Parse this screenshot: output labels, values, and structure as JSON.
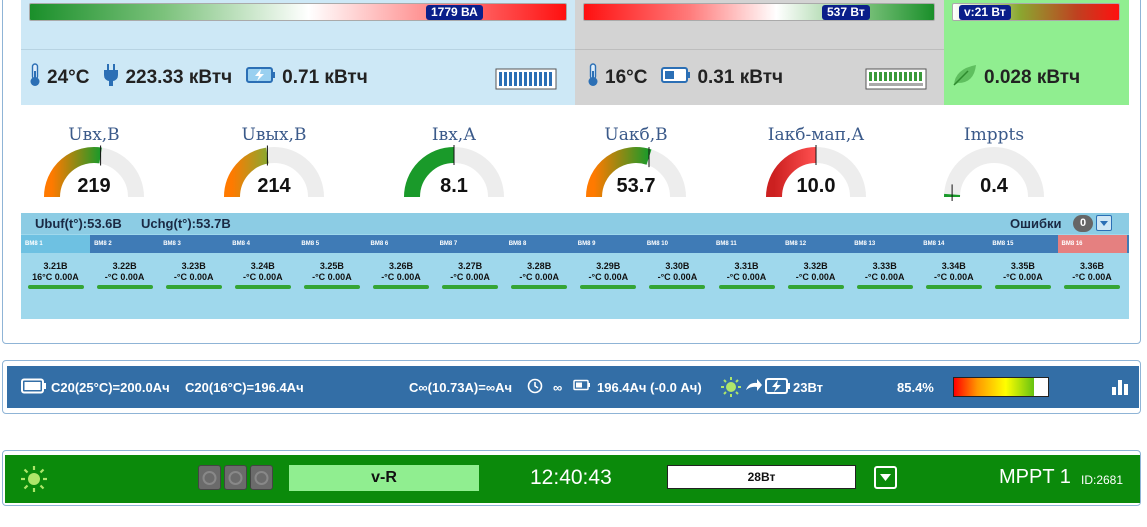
{
  "top": {
    "grid": {
      "gradient_value": "1779 ВА",
      "temp": "24°C",
      "energy_in": "223.33 кВтч",
      "energy_bat": "0.71 кВтч"
    },
    "battery": {
      "gradient_value": "537 Вт",
      "temp": "16°C",
      "energy": "0.31 кВтч"
    },
    "pv": {
      "gradient_value": "v:21 Вт",
      "energy": "0.028 кВтч"
    }
  },
  "gauges": [
    {
      "label": "Uвх,В",
      "value": "219",
      "level": 0.55,
      "colors": [
        "#ff7a00",
        "#1a9a2a"
      ]
    },
    {
      "label": "Uвых,В",
      "value": "214",
      "level": 0.45,
      "colors": [
        "#ff7a00",
        "#8aa830"
      ]
    },
    {
      "label": "Iвх,А",
      "value": "8.1",
      "level": 0.5,
      "colors": [
        "#1a9a2a",
        "#1a9a2a"
      ]
    },
    {
      "label": "Uакб,В",
      "value": "53.7",
      "level": 0.6,
      "colors": [
        "#ff7a00",
        "#1a9a2a"
      ]
    },
    {
      "label": "Iакб-мап,А",
      "value": "10.0",
      "level": 0.5,
      "colors": [
        "#cc2020",
        "#ff5050"
      ]
    },
    {
      "label": "Imppts",
      "value": "0.4",
      "level": 0.02,
      "colors": [
        "#1a9a2a",
        "#1a9a2a"
      ]
    }
  ],
  "bms": {
    "ubuf": "Ubuf(t°):53.6В",
    "uchg": "Uchg(t°):53.7В",
    "errors_label": "Ошибки",
    "errors_count": "0",
    "modules": [
      "BM8 1",
      "BM8 2",
      "BM8 3",
      "BM8 4",
      "BM8 5",
      "BM8 6",
      "BM8 7",
      "BM8 8",
      "BM8 9",
      "BM8 10",
      "BM8 11",
      "BM8 12",
      "BM8 13",
      "BM8 14",
      "BM8 15",
      "BM8 16"
    ],
    "cells": [
      {
        "v": "3.21В",
        "t": "16°C 0.00A"
      },
      {
        "v": "3.22В",
        "t": "-°C 0.00A"
      },
      {
        "v": "3.23В",
        "t": "-°C 0.00A"
      },
      {
        "v": "3.24В",
        "t": "-°C 0.00A"
      },
      {
        "v": "3.25В",
        "t": "-°C 0.00A"
      },
      {
        "v": "3.26В",
        "t": "-°C 0.00A"
      },
      {
        "v": "3.27В",
        "t": "-°C 0.00A"
      },
      {
        "v": "3.28В",
        "t": "-°C 0.00A"
      },
      {
        "v": "3.29В",
        "t": "-°C 0.00A"
      },
      {
        "v": "3.30В",
        "t": "-°C 0.00A"
      },
      {
        "v": "3.31В",
        "t": "-°C 0.00A"
      },
      {
        "v": "3.32В",
        "t": "-°C 0.00A"
      },
      {
        "v": "3.33В",
        "t": "-°C 0.00A"
      },
      {
        "v": "3.34В",
        "t": "-°C 0.00A"
      },
      {
        "v": "3.35В",
        "t": "-°C 0.00A"
      },
      {
        "v": "3.36В",
        "t": "-°C 0.00A"
      }
    ]
  },
  "battery_bar": {
    "c20_25": "C20(25°C)=200.0Ач",
    "c20_16": "C20(16°C)=196.4Ач",
    "cinf": "C∞(10.73A)=∞Ач",
    "time": "∞",
    "capacity": "196.4Ач (-0.0 Ач)",
    "pv_charge": "23Вт",
    "soc": "85.4%",
    "soc_level": 0.854
  },
  "mppt": {
    "mode": "v-R",
    "clock": "12:40:43",
    "power": "28Вт",
    "name": "MPPT 1",
    "id": "ID:2681"
  }
}
